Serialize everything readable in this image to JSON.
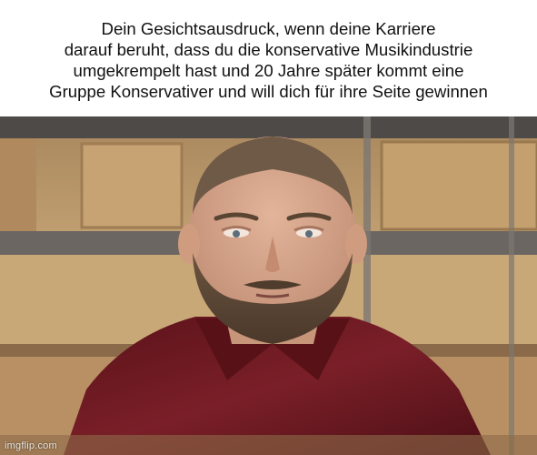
{
  "meme": {
    "caption": "Dein Gesichtsausdruck, wenn deine Karriere\ndarauf beruht, dass du die konservative Musikindustrie\numgekrempelt hast und 20 Jahre später kommt eine\nGruppe Konservativer und will dich für ihre Seite gewinnen",
    "watermark": "imgflip.com"
  },
  "colors": {
    "wood_light": "#c8a676",
    "wood_dark": "#8a6a48",
    "jacket": "#6e1a22",
    "skin": "#d8a98e",
    "hair_beard": "#5b4634"
  }
}
